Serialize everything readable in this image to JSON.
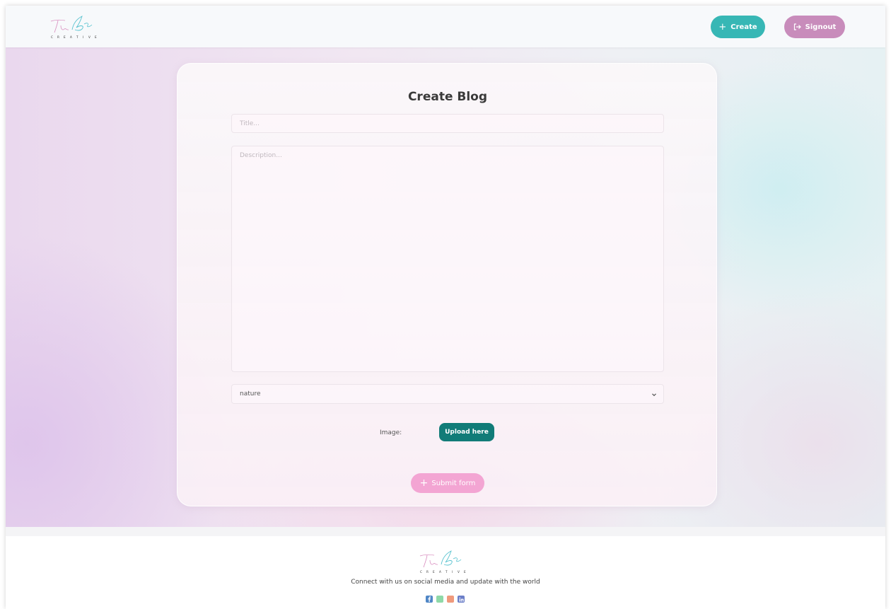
{
  "nav": {
    "create_label": "Create",
    "create_icon": "plus-icon",
    "signout_label": "Signout",
    "signout_icon": "sign-out-icon"
  },
  "form": {
    "title": "Create Blog",
    "title_placeholder": "Title...",
    "description_placeholder": "Description...",
    "category_value": "nature",
    "image_label": "Image:",
    "upload_label": "Upload here",
    "submit_label": "Submit form"
  },
  "footer": {
    "tagline": "Connect with us on social media and update with the world",
    "socials": [
      "facebook-icon",
      "green-icon",
      "orange-icon",
      "linkedin-icon"
    ]
  },
  "colors": {
    "create_button": "#37b7b5",
    "signout_button": "#c88cbb",
    "upload_button": "#117c78",
    "submit_button": "#f3a5d3",
    "facebook": "#4f86c6",
    "green": "#8fd9a8",
    "orange": "#f09a7c",
    "linkedin": "#6c7fc8"
  }
}
